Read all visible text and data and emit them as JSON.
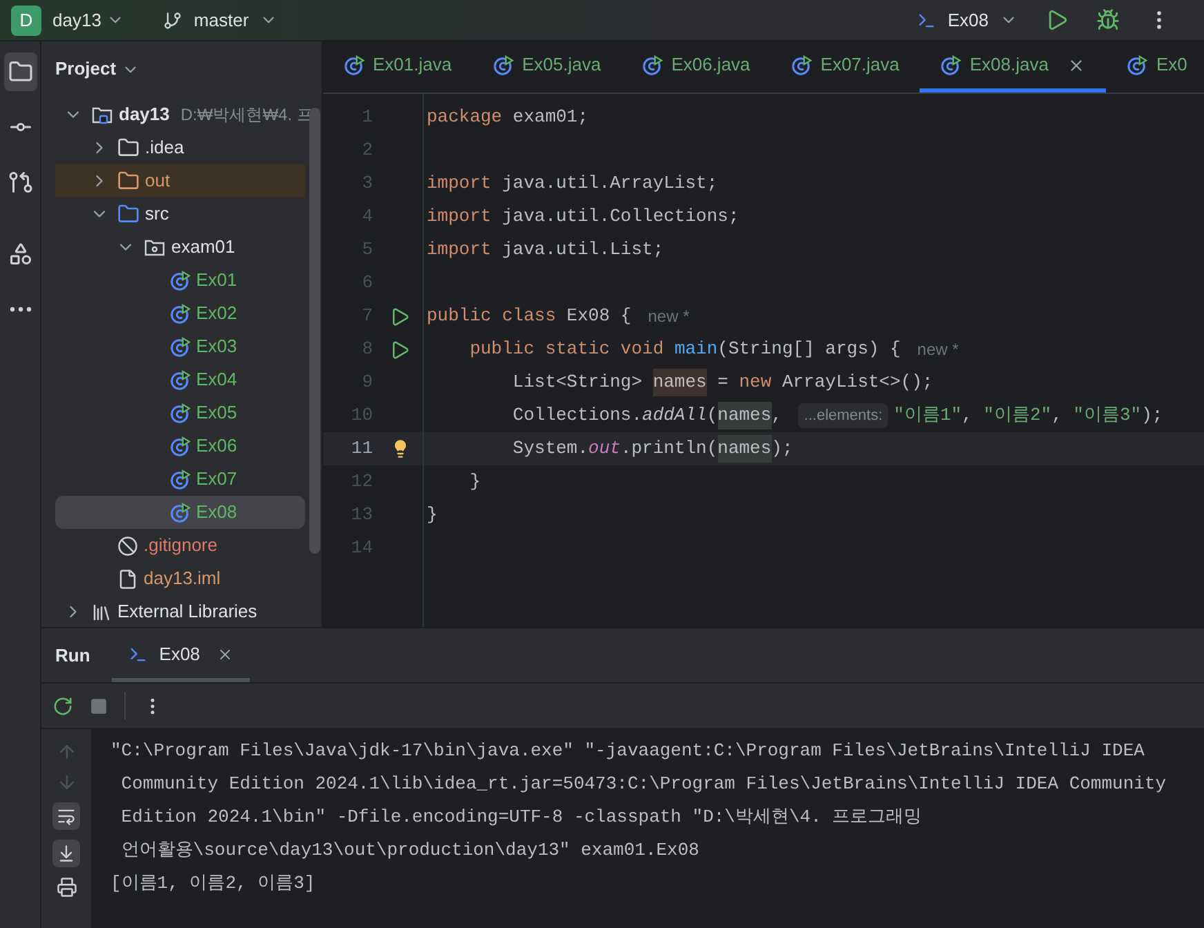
{
  "top_bar": {
    "project_badge": "D",
    "project": "day13",
    "branch": "master",
    "run_config": "Ex08"
  },
  "tool_strip": [
    {
      "kind": "project",
      "selected": true
    },
    {
      "kind": "commit",
      "selected": false
    },
    {
      "kind": "pull-requests",
      "selected": false
    },
    {
      "kind": "structure",
      "selected": false
    },
    {
      "kind": "more",
      "selected": false
    }
  ],
  "project_panel": {
    "title": "Project",
    "tree": [
      {
        "kind": "module",
        "label": "day13",
        "path": "D:₩박세현₩4. 프",
        "expanded": true,
        "selected": false,
        "children": [
          {
            "kind": "folder",
            "label": ".idea",
            "expanded": false,
            "selected": false
          },
          {
            "kind": "excluded-folder",
            "label": "out",
            "expanded": false,
            "selected": false
          },
          {
            "kind": "source-folder",
            "label": "src",
            "expanded": true,
            "selected": false,
            "children": [
              {
                "kind": "package",
                "label": "exam01",
                "expanded": true,
                "selected": false,
                "children": [
                  {
                    "kind": "class",
                    "label": "Ex01",
                    "color": "#5fb865",
                    "selected": false
                  },
                  {
                    "kind": "class",
                    "label": "Ex02",
                    "color": "#5fb865",
                    "selected": false
                  },
                  {
                    "kind": "class",
                    "label": "Ex03",
                    "color": "#5fb865",
                    "selected": false
                  },
                  {
                    "kind": "class",
                    "label": "Ex04",
                    "color": "#5fb865",
                    "selected": false
                  },
                  {
                    "kind": "class",
                    "label": "Ex05",
                    "color": "#5fb865",
                    "selected": false
                  },
                  {
                    "kind": "class",
                    "label": "Ex06",
                    "color": "#5fb865",
                    "selected": false
                  },
                  {
                    "kind": "class",
                    "label": "Ex07",
                    "color": "#5fb865",
                    "selected": false
                  },
                  {
                    "kind": "class",
                    "label": "Ex08",
                    "color": "#5fb865",
                    "selected": true
                  }
                ]
              }
            ]
          },
          {
            "kind": "ignore-file",
            "label": ".gitignore",
            "color": "#e07b6a",
            "selected": false
          },
          {
            "kind": "module-file",
            "label": "day13.iml",
            "color": "#d5976b",
            "selected": false
          }
        ]
      },
      {
        "kind": "libraries",
        "label": "External Libraries",
        "expanded": false,
        "selected": false
      }
    ]
  },
  "editor_tabs": [
    {
      "label": "Ex01.java",
      "selected": false
    },
    {
      "label": "Ex05.java",
      "selected": false
    },
    {
      "label": "Ex06.java",
      "selected": false
    },
    {
      "label": "Ex07.java",
      "selected": false
    },
    {
      "label": "Ex08.java",
      "selected": true
    },
    {
      "label": "Ex0",
      "selected": false
    }
  ],
  "code": [
    {
      "number": "1",
      "run": false,
      "bulb": false,
      "current": false,
      "tokens": [
        {
          "t": "package",
          "kind": "keyword"
        },
        {
          "t": " exam01;",
          "kind": "plain"
        }
      ]
    },
    {
      "number": "2",
      "run": false,
      "bulb": false,
      "current": false
    },
    {
      "number": "3",
      "run": false,
      "bulb": false,
      "current": false,
      "tokens": [
        {
          "t": "import",
          "kind": "keyword"
        },
        {
          "t": " java.util.ArrayList;",
          "kind": "plain"
        }
      ]
    },
    {
      "number": "4",
      "run": false,
      "bulb": false,
      "current": false,
      "tokens": [
        {
          "t": "import",
          "kind": "keyword"
        },
        {
          "t": " java.util.Collections;",
          "kind": "plain"
        }
      ]
    },
    {
      "number": "5",
      "run": false,
      "bulb": false,
      "current": false,
      "tokens": [
        {
          "t": "import",
          "kind": "keyword"
        },
        {
          "t": " java.util.List;",
          "kind": "plain"
        }
      ]
    },
    {
      "number": "6",
      "run": false,
      "bulb": false,
      "current": false
    },
    {
      "number": "7",
      "run": true,
      "bulb": false,
      "current": false,
      "tokens": [
        {
          "t": "public class",
          "kind": "keyword"
        },
        {
          "t": " Ex08 {",
          "kind": "plain"
        },
        {
          "t": "new *",
          "kind": "hint"
        }
      ]
    },
    {
      "number": "8",
      "run": true,
      "bulb": false,
      "current": false,
      "tokens": [
        {
          "t": "    public static void ",
          "kind": "keyword"
        },
        {
          "t": "main",
          "kind": "declaration"
        },
        {
          "t": "(String[] args) {",
          "kind": "plain"
        },
        {
          "t": "new *",
          "kind": "hint"
        }
      ]
    },
    {
      "number": "9",
      "run": false,
      "bulb": false,
      "current": false,
      "tokens": [
        {
          "t": "        List<String> ",
          "kind": "plain"
        },
        {
          "t": "names",
          "kind": "write-usage"
        },
        {
          "t": " = ",
          "kind": "plain"
        },
        {
          "t": "new",
          "kind": "keyword"
        },
        {
          "t": " ArrayList<>();",
          "kind": "plain"
        }
      ]
    },
    {
      "number": "10",
      "run": false,
      "bulb": false,
      "current": false,
      "tokens": [
        {
          "t": "        Collections.",
          "kind": "plain"
        },
        {
          "t": "addAll",
          "kind": "static-call"
        },
        {
          "t": "(",
          "kind": "plain"
        },
        {
          "t": "names",
          "kind": "read-usage"
        },
        {
          "t": ", ",
          "kind": "plain"
        },
        {
          "t": "...elements:",
          "kind": "inlay"
        },
        {
          "t": "\"이름1\"",
          "kind": "string"
        },
        {
          "t": ", ",
          "kind": "plain"
        },
        {
          "t": "\"이름2\"",
          "kind": "string"
        },
        {
          "t": ", ",
          "kind": "plain"
        },
        {
          "t": "\"이름3\"",
          "kind": "string"
        },
        {
          "t": ");",
          "kind": "plain"
        }
      ]
    },
    {
      "number": "11",
      "run": false,
      "bulb": true,
      "current": true,
      "tokens": [
        {
          "t": "        System.",
          "kind": "plain"
        },
        {
          "t": "out",
          "kind": "static-field"
        },
        {
          "t": ".println(",
          "kind": "plain"
        },
        {
          "t": "names",
          "kind": "read-usage"
        },
        {
          "t": ");",
          "kind": "plain"
        }
      ]
    },
    {
      "number": "12",
      "run": false,
      "bulb": false,
      "current": false,
      "tokens": [
        {
          "t": "    }",
          "kind": "plain"
        }
      ]
    },
    {
      "number": "13",
      "run": false,
      "bulb": false,
      "current": false,
      "tokens": [
        {
          "t": "}",
          "kind": "plain"
        }
      ]
    },
    {
      "number": "14",
      "run": false,
      "bulb": false,
      "current": false
    }
  ],
  "run_panel": {
    "title": "Run",
    "tabs": [
      {
        "label": "Ex08",
        "selected": true
      }
    ],
    "console": [
      "\"C:\\Program Files\\Java\\jdk-17\\bin\\java.exe\" \"-javaagent:C:\\Program Files\\JetBrains\\IntelliJ IDEA",
      " Community Edition 2024.1\\lib\\idea_rt.jar=50473:C:\\Program Files\\JetBrains\\IntelliJ IDEA Community",
      " Edition 2024.1\\bin\" -Dfile.encoding=UTF-8 -classpath \"D:\\박세현\\4. 프로그래밍",
      " 언어활용\\source\\day13\\out\\production\\day13\" exam01.Ex08",
      "[이름1, 이름2, 이름3]"
    ]
  }
}
